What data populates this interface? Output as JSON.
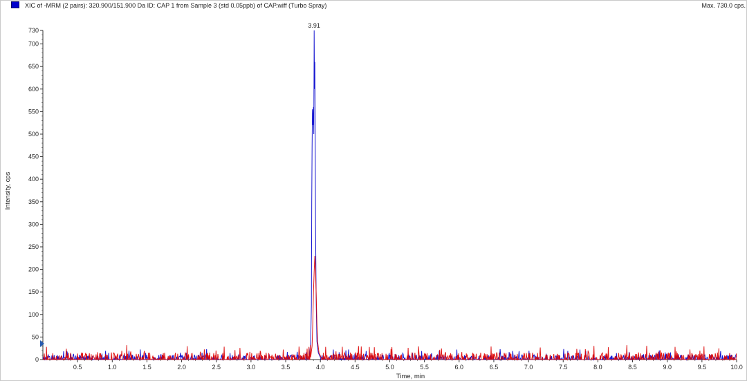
{
  "title": "XIC of -MRM (2 pairs): 320.900/151.900 Da ID: CAP 1 from Sample 3 (std 0.05ppb) of CAP.wiff (Turbo Spray)",
  "max_label": "Max. 730.0 cps.",
  "colors": {
    "blue": "#0000cc",
    "red": "#dd0000",
    "axis": "#333333"
  },
  "chart_data": {
    "type": "line",
    "xlabel": "Time, min",
    "ylabel": "Intensity, cps",
    "xlim": [
      0,
      10.0
    ],
    "ylim": [
      0,
      730
    ],
    "x_ticks": [
      0.5,
      1.0,
      1.5,
      2.0,
      2.5,
      3.0,
      3.5,
      4.0,
      4.5,
      5.0,
      5.5,
      6.0,
      6.5,
      7.0,
      7.5,
      8.0,
      8.5,
      9.0,
      9.5,
      10.0
    ],
    "x_tick_labels": [
      "0.5",
      "1.0",
      "1.5",
      "2.0",
      "2.5",
      "3.0",
      "3.5",
      "4.0",
      "4.5",
      "5.0",
      "5.5",
      "6.0",
      "6.5",
      "7.0",
      "7.5",
      "8.0",
      "8.5",
      "9.0",
      "9.5",
      "10.0"
    ],
    "y_ticks": [
      0,
      50,
      100,
      150,
      200,
      250,
      300,
      350,
      400,
      450,
      500,
      550,
      600,
      650,
      700,
      730
    ],
    "y_tick_labels": [
      "0",
      "50",
      "100",
      "150",
      "200",
      "250",
      "300",
      "350",
      "400",
      "450",
      "500",
      "550",
      "600",
      "650",
      "700",
      "730"
    ],
    "peak_annotation": {
      "label": "3.91",
      "x": 3.91,
      "y": 730
    },
    "series": [
      {
        "color": "#0000cc",
        "peak": {
          "x": [
            3.84,
            3.86,
            3.87,
            3.875,
            3.88,
            3.885,
            3.89,
            3.895,
            3.9,
            3.905,
            3.91,
            3.915,
            3.92,
            3.925,
            3.93,
            3.94,
            3.95,
            3.97,
            4.0
          ],
          "y": [
            5,
            40,
            120,
            350,
            470,
            555,
            540,
            520,
            560,
            500,
            730,
            600,
            660,
            500,
            300,
            120,
            40,
            15,
            5
          ]
        },
        "noise_max": 18
      },
      {
        "color": "#dd0000",
        "peak": {
          "x": [
            3.86,
            3.88,
            3.89,
            3.9,
            3.91,
            3.92,
            3.93,
            3.94,
            3.95,
            3.96,
            3.98,
            4.01
          ],
          "y": [
            5,
            30,
            80,
            150,
            195,
            230,
            200,
            140,
            80,
            40,
            15,
            5
          ]
        },
        "noise_max": 26
      }
    ]
  }
}
